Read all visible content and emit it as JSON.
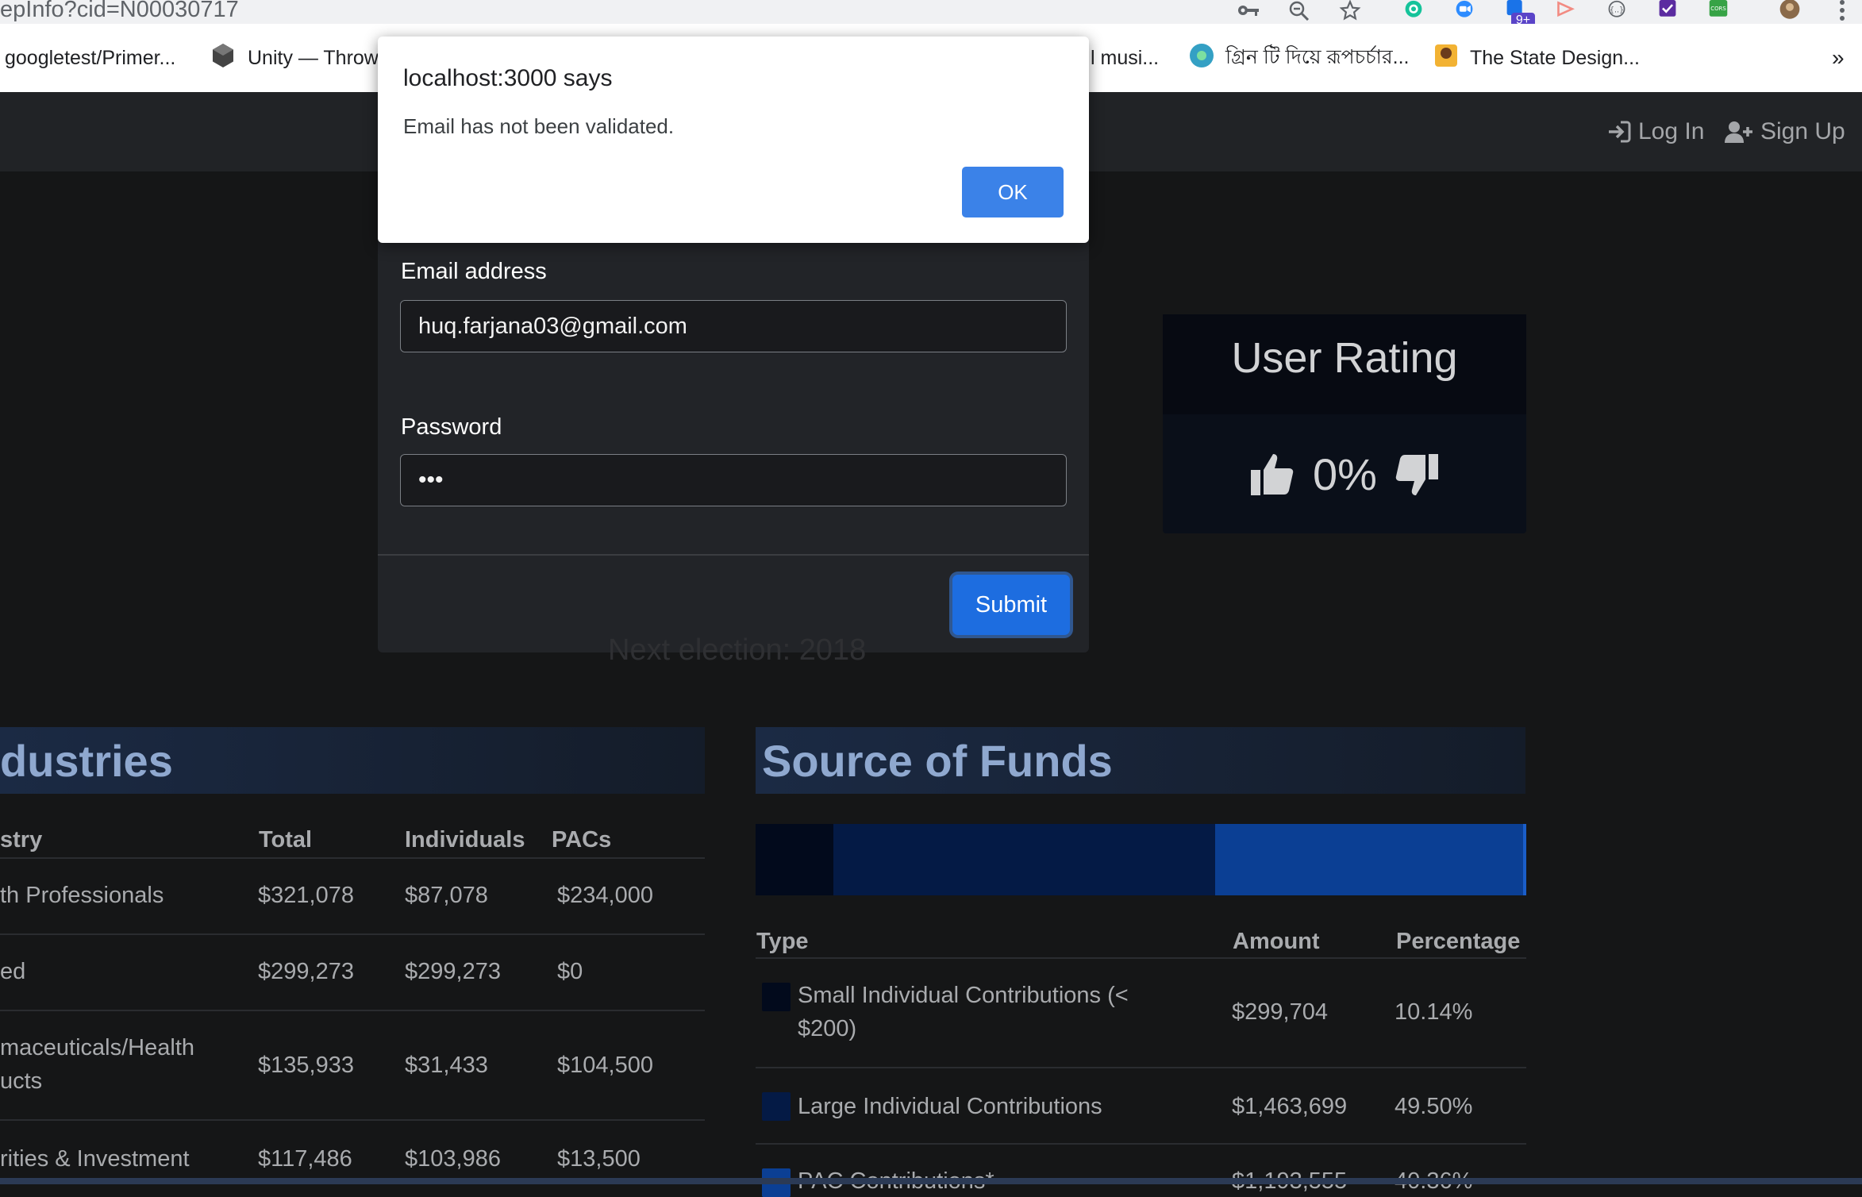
{
  "browser": {
    "url": "epInfo?cid=N00030717",
    "extension_badge": "9+",
    "bookmarks": [
      {
        "label": "googletest/Primer...",
        "icon": ""
      },
      {
        "label": "Unity — Throw",
        "icon": "unity-icon"
      },
      {
        "label": "l musi...",
        "icon": ""
      },
      {
        "label": "গ্রিন টি দিয়ে রূপচর্চার...",
        "icon": "site-icon"
      },
      {
        "label": "The State Design...",
        "icon": "site-icon"
      }
    ],
    "overflow": "»"
  },
  "nav": {
    "login": "Log In",
    "signup": "Sign Up"
  },
  "alert": {
    "title": "localhost:3000 says",
    "message": "Email has not been validated.",
    "ok": "OK"
  },
  "login_form": {
    "email_label": "Email address",
    "email_value": "huq.farjana03@gmail.com",
    "password_label": "Password",
    "password_value": "•••",
    "submit": "Submit"
  },
  "rating": {
    "title": "User Rating",
    "value": "0%"
  },
  "next_election": "Next election: 2018",
  "industries": {
    "title": "dustries",
    "columns": [
      "stry",
      "Total",
      "Individuals",
      "PACs"
    ],
    "rows": [
      {
        "name": "th Professionals",
        "name2": "",
        "total": "$321,078",
        "indiv": "$87,078",
        "pacs": "$234,000"
      },
      {
        "name": "ed",
        "name2": "",
        "total": "$299,273",
        "indiv": "$299,273",
        "pacs": "$0"
      },
      {
        "name": "maceuticals/Health",
        "name2": "ucts",
        "total": "$135,933",
        "indiv": "$31,433",
        "pacs": "$104,500"
      },
      {
        "name": "rities & Investment",
        "name2": "",
        "total": "$117,486",
        "indiv": "$103,986",
        "pacs": "$13,500"
      }
    ]
  },
  "source_of_funds": {
    "title": "Source of Funds",
    "columns": [
      "Type",
      "Amount",
      "Percentage"
    ],
    "rows": [
      {
        "type": "Small Individual Contributions (<",
        "type2": "$200)",
        "amount": "$299,704",
        "pct": "10.14%",
        "color": "#020a1c"
      },
      {
        "type": "Large Individual Contributions",
        "type2": "",
        "amount": "$1,463,699",
        "pct": "49.50%",
        "color": "#041a45"
      },
      {
        "type": "PAC Contributions*",
        "type2": "",
        "amount": "$1,193,555",
        "pct": "40.36%",
        "color": "#0b3f94"
      }
    ],
    "bar": [
      {
        "share": 10.14,
        "color": "#020a1c"
      },
      {
        "share": 49.5,
        "color": "#041a45"
      },
      {
        "share": 40.36,
        "color": "#0b3f94"
      }
    ]
  }
}
